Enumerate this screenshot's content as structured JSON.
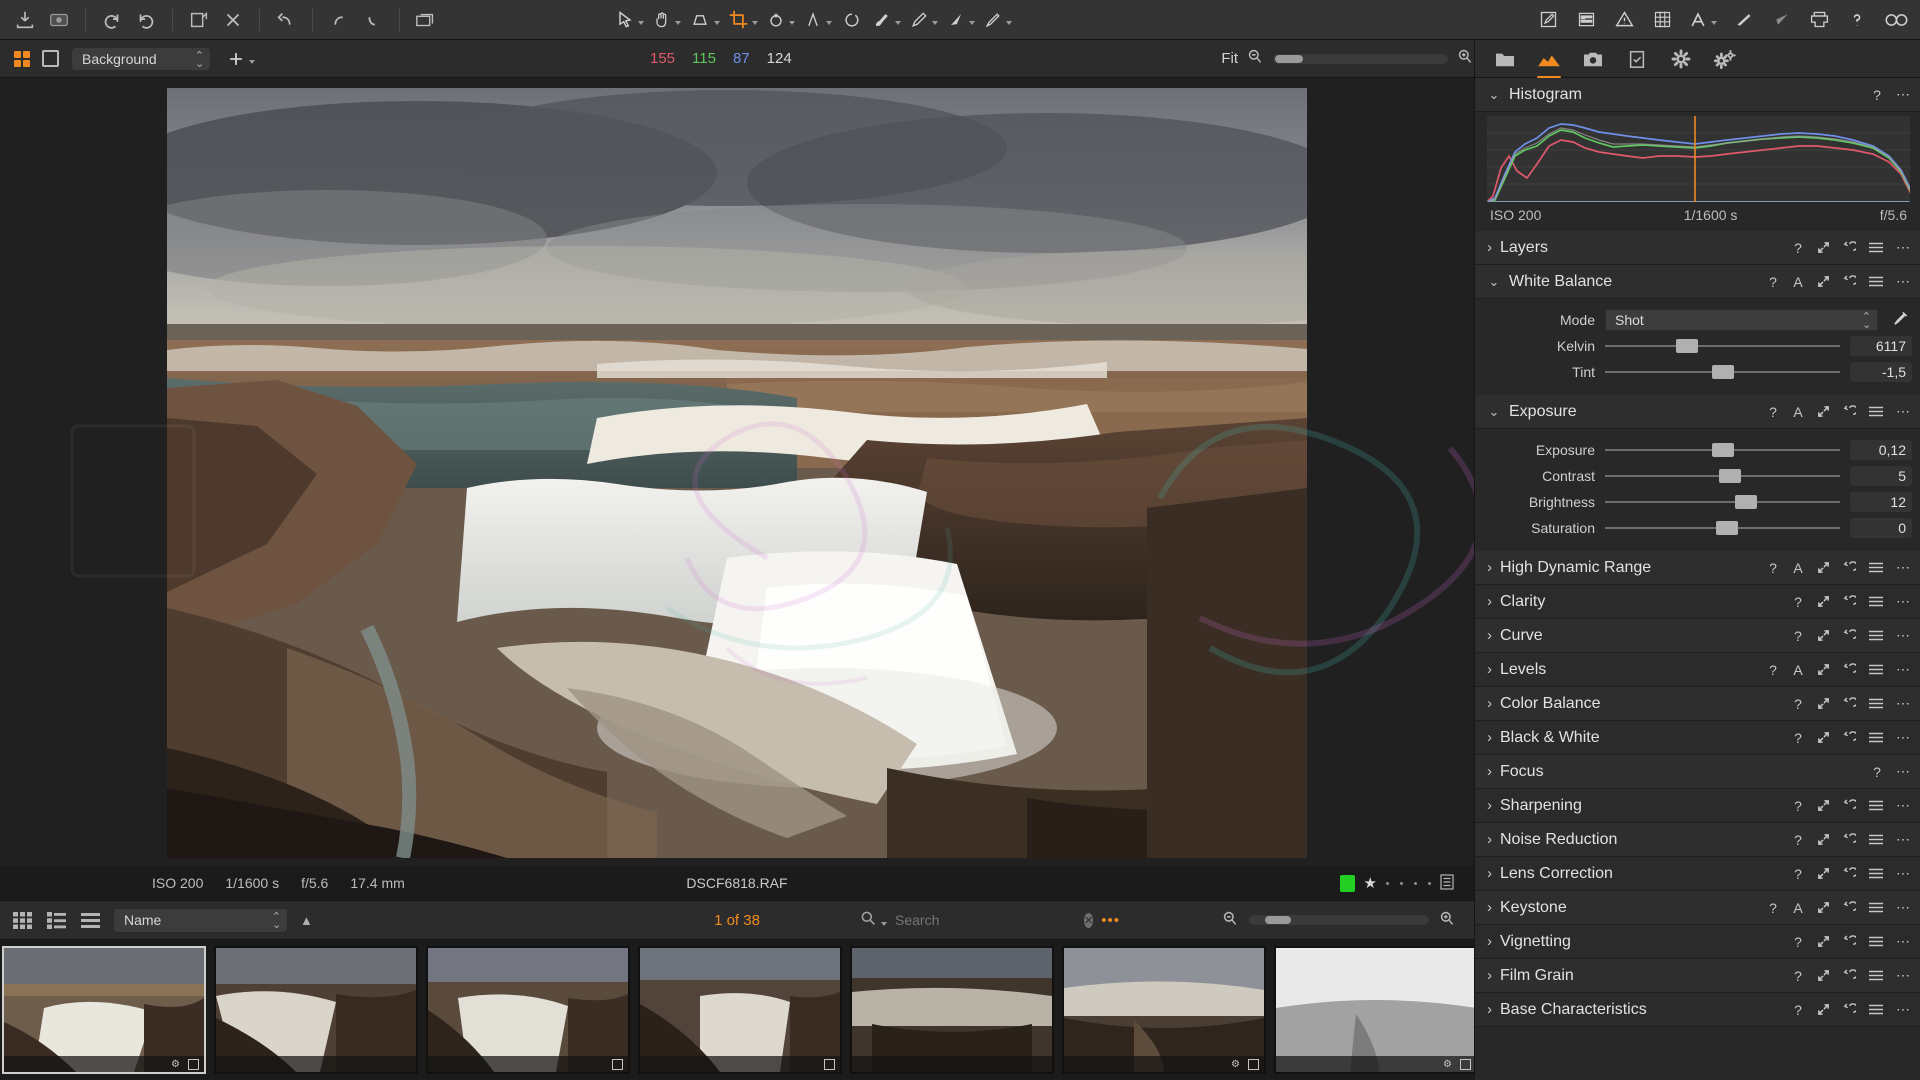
{
  "toolbar_top": {
    "left_tools": [
      {
        "name": "import-icon",
        "label": "Import"
      },
      {
        "name": "capture-icon",
        "label": "Capture"
      },
      {
        "name": "rotate-left-icon",
        "label": "Rotate Left"
      },
      {
        "name": "rotate-right-icon",
        "label": "Rotate Right"
      },
      {
        "name": "copy-apply-icon",
        "label": "Copy and Apply Adjustments"
      },
      {
        "name": "reset-icon",
        "label": "Reset Adjustments"
      },
      {
        "name": "undo-icon",
        "label": "Undo"
      },
      {
        "name": "redo-icon",
        "label": "Redo"
      },
      {
        "name": "redo-alt-icon",
        "label": "Redo Alt"
      },
      {
        "name": "variants-icon",
        "label": "Clone Variant"
      }
    ],
    "center_tools": [
      {
        "name": "pointer-tool-icon",
        "label": "Select",
        "active": false,
        "caret": true
      },
      {
        "name": "pan-tool-icon",
        "label": "Pan",
        "active": false,
        "caret": true
      },
      {
        "name": "keystone-tool-icon",
        "label": "Keystone",
        "active": false,
        "caret": true
      },
      {
        "name": "crop-tool-icon",
        "label": "Crop",
        "active": true,
        "caret": true
      },
      {
        "name": "spot-tool-icon",
        "label": "Spot Removal",
        "active": false,
        "caret": true
      },
      {
        "name": "straighten-tool-icon",
        "label": "Straighten",
        "active": false,
        "caret": true
      },
      {
        "name": "rotate-tool-icon",
        "label": "Rotate",
        "active": false,
        "caret": false
      },
      {
        "name": "brush-tool-icon",
        "label": "Draw Mask",
        "active": false,
        "caret": true
      },
      {
        "name": "pen-tool-icon",
        "label": "Erase Mask",
        "active": false,
        "caret": true
      },
      {
        "name": "gradient-tool-icon",
        "label": "Linear Gradient Mask",
        "active": false,
        "caret": true
      },
      {
        "name": "heal-tool-icon",
        "label": "Heal",
        "active": false,
        "caret": true
      }
    ],
    "right_tools": [
      {
        "name": "annotation-icon",
        "label": "Annotations"
      },
      {
        "name": "keywords-icon",
        "label": "Keywords"
      },
      {
        "name": "exposure-warning-icon",
        "label": "Exposure Warning"
      },
      {
        "name": "grid-overlay-icon",
        "label": "Grid"
      },
      {
        "name": "text-tool-icon",
        "label": "Text",
        "caret": true
      },
      {
        "name": "highlight-icon",
        "label": "Highlight"
      },
      {
        "name": "shadow-icon",
        "label": "Shadow"
      },
      {
        "name": "print-icon",
        "label": "Print"
      },
      {
        "name": "help-icon",
        "label": "Help"
      },
      {
        "name": "proof-icon",
        "label": "Proofing"
      }
    ]
  },
  "toolbar_second": {
    "grid_view_icon": "grid-view-icon",
    "single_view_icon": "single-view-icon",
    "layer_select": {
      "value": "Background",
      "name": "background-layer-select"
    },
    "add_layer_icon": "add-layer-icon",
    "readout": {
      "r": "155",
      "g": "115",
      "b": "87",
      "k": "124"
    },
    "zoom": {
      "fit_label": "Fit",
      "zoom_out_icon": "zoom-out-icon",
      "zoom_in_icon": "zoom-in-icon",
      "value": 3
    },
    "panel_tabs": [
      {
        "name": "library-tab",
        "icon": "folder-icon",
        "label": "Library",
        "active": false
      },
      {
        "name": "adjustments-tab",
        "icon": "exposure-icon",
        "label": "Adjustments",
        "active": true
      },
      {
        "name": "camera-tab",
        "icon": "camera-icon",
        "label": "Capture",
        "active": false
      },
      {
        "name": "metadata-tab",
        "icon": "clipboard-icon",
        "label": "Metadata",
        "active": false
      },
      {
        "name": "output-tab",
        "icon": "gear-icon",
        "label": "Output",
        "active": false
      },
      {
        "name": "batch-tab",
        "icon": "gears-icon",
        "label": "Batch",
        "active": false
      }
    ]
  },
  "image_info": {
    "iso": "ISO 200",
    "shutter": "1/1600 s",
    "aperture": "f/5.6",
    "focal": "17.4 mm",
    "filename": "DSCF6818.RAF",
    "color_tag": "green",
    "rating_star": "★",
    "rating_dots": 4,
    "info-icon": "list-icon"
  },
  "browser_bar": {
    "view_icons": [
      {
        "name": "browser-grid-view-icon",
        "label": "Grid View"
      },
      {
        "name": "browser-list-view-icon",
        "label": "List View"
      },
      {
        "name": "browser-filmstrip-view-icon",
        "label": "Filmstrip View"
      }
    ],
    "sort": {
      "value": "Name",
      "name": "sort-select",
      "direction_icon": "sort-ascending-icon"
    },
    "counter": "1 of 38",
    "search": {
      "placeholder": "Search",
      "value": "",
      "icon": "search-icon",
      "clear_icon": "clear-icon",
      "more_icon": "more-icon"
    },
    "thumb_zoom": {
      "zoom_out_icon": "thumb-zoom-out-icon",
      "zoom_in_icon": "thumb-zoom-in-icon",
      "value": 18
    }
  },
  "filmstrip": {
    "thumbs": [
      {
        "name": "thumb-1",
        "selected": true,
        "badges": [
          "gear",
          "list"
        ]
      },
      {
        "name": "thumb-2",
        "selected": false,
        "badges": []
      },
      {
        "name": "thumb-3",
        "selected": false,
        "badges": [
          "list"
        ]
      },
      {
        "name": "thumb-4",
        "selected": false,
        "badges": [
          "list"
        ]
      },
      {
        "name": "thumb-5",
        "selected": false,
        "badges": []
      },
      {
        "name": "thumb-6",
        "selected": false,
        "badges": [
          "gear",
          "list"
        ]
      },
      {
        "name": "thumb-7",
        "selected": false,
        "badges": [
          "gear",
          "list"
        ]
      }
    ]
  },
  "right_panel": {
    "histogram": {
      "title": "Histogram",
      "expanded": true,
      "icons": [
        "?",
        "…"
      ],
      "iso": "ISO 200",
      "shutter": "1/1600 s",
      "aperture": "f/5.6"
    },
    "layers": {
      "title": "Layers",
      "expanded": false,
      "icons": [
        "?",
        "expand",
        "reset",
        "menu",
        "…"
      ]
    },
    "white_balance": {
      "title": "White Balance",
      "expanded": true,
      "icons": [
        "?",
        "A",
        "expand",
        "reset",
        "menu",
        "…"
      ],
      "mode": {
        "label": "Mode",
        "value": "Shot"
      },
      "eyedropper_icon": "eyedropper-icon",
      "sliders": [
        {
          "label": "Kelvin",
          "value": "6117",
          "pos": 35
        },
        {
          "label": "Tint",
          "value": "-1,5",
          "pos": 50
        }
      ]
    },
    "exposure": {
      "title": "Exposure",
      "expanded": true,
      "icons": [
        "?",
        "A",
        "expand",
        "reset",
        "menu",
        "…"
      ],
      "sliders": [
        {
          "label": "Exposure",
          "value": "0,12",
          "pos": 50
        },
        {
          "label": "Contrast",
          "value": "5",
          "pos": 53
        },
        {
          "label": "Brightness",
          "value": "12",
          "pos": 60
        },
        {
          "label": "Saturation",
          "value": "0",
          "pos": 52
        }
      ]
    },
    "tools": [
      {
        "title": "High Dynamic Range",
        "icons": [
          "?",
          "A",
          "expand",
          "reset",
          "menu",
          "…"
        ]
      },
      {
        "title": "Clarity",
        "icons": [
          "?",
          "expand",
          "reset",
          "menu",
          "…"
        ]
      },
      {
        "title": "Curve",
        "icons": [
          "?",
          "expand",
          "reset",
          "menu",
          "…"
        ]
      },
      {
        "title": "Levels",
        "icons": [
          "?",
          "A",
          "expand",
          "reset",
          "menu",
          "…"
        ]
      },
      {
        "title": "Color Balance",
        "icons": [
          "?",
          "expand",
          "reset",
          "menu",
          "…"
        ]
      },
      {
        "title": "Black & White",
        "icons": [
          "?",
          "expand",
          "reset",
          "menu",
          "…"
        ]
      },
      {
        "title": "Focus",
        "icons": [
          "?",
          "…"
        ]
      },
      {
        "title": "Sharpening",
        "icons": [
          "?",
          "expand",
          "reset",
          "menu",
          "…"
        ]
      },
      {
        "title": "Noise Reduction",
        "icons": [
          "?",
          "expand",
          "reset",
          "menu",
          "…"
        ]
      },
      {
        "title": "Lens Correction",
        "icons": [
          "?",
          "expand",
          "reset",
          "menu",
          "…"
        ]
      },
      {
        "title": "Keystone",
        "icons": [
          "?",
          "A",
          "expand",
          "reset",
          "menu",
          "…"
        ]
      },
      {
        "title": "Vignetting",
        "icons": [
          "?",
          "expand",
          "reset",
          "menu",
          "…"
        ]
      },
      {
        "title": "Film Grain",
        "icons": [
          "?",
          "expand",
          "reset",
          "menu",
          "…"
        ]
      },
      {
        "title": "Base Characteristics",
        "icons": [
          "?",
          "expand",
          "reset",
          "menu",
          "…"
        ]
      }
    ]
  },
  "colors": {
    "accent": "#f08a20",
    "panel_bg": "#282828",
    "toolbar_bg": "#343434",
    "viewer_bg": "#202020",
    "histogram_red": "#e0596b",
    "histogram_green": "#5ec85e",
    "histogram_blue": "#6f8fe8"
  }
}
